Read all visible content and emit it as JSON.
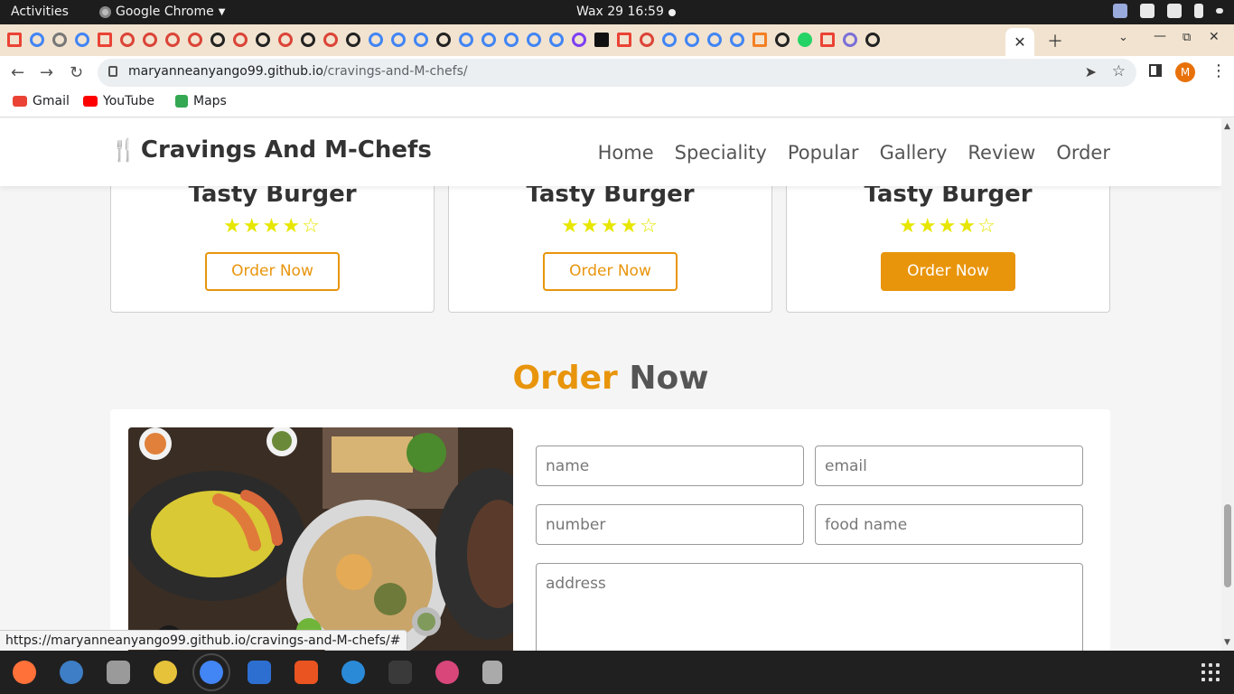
{
  "system_bar": {
    "activities": "Activities",
    "app_name": "Google Chrome",
    "clock": "Wax 29  16:59"
  },
  "browser": {
    "url_host": "maryanneanyango99.github.io",
    "url_path": "/cravings-and-M-chefs/",
    "profile_initial": "M",
    "bookmarks": [
      {
        "label": "Gmail"
      },
      {
        "label": "YouTube"
      },
      {
        "label": "Maps"
      }
    ],
    "status_url": "https://maryanneanyango99.github.io/cravings-and-M-chefs/#"
  },
  "site": {
    "logo": "Cravings And M-Chefs",
    "nav": [
      "Home",
      "Speciality",
      "Popular",
      "Gallery",
      "Review",
      "Order"
    ]
  },
  "cards": [
    {
      "title": "Tasty Burger",
      "rating": 4,
      "max_rating": 5,
      "button": "Order Now",
      "highlighted": false
    },
    {
      "title": "Tasty Burger",
      "rating": 4,
      "max_rating": 5,
      "button": "Order Now",
      "highlighted": false
    },
    {
      "title": "Tasty Burger",
      "rating": 4,
      "max_rating": 5,
      "button": "Order Now",
      "highlighted": true
    }
  ],
  "order_section": {
    "heading_accent": "Order",
    "heading_rest": "Now",
    "fields": {
      "name": "name",
      "email": "email",
      "number": "number",
      "food_name": "food name",
      "address": "address"
    }
  },
  "colors": {
    "accent": "#e8950c",
    "star": "#e6e600"
  }
}
